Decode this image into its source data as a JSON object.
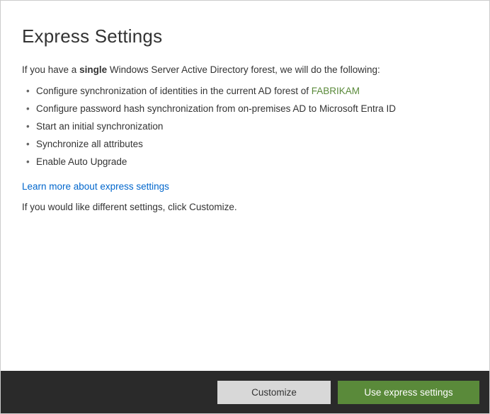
{
  "header": {
    "title": "Express Settings"
  },
  "intro": {
    "prefix": "If you have a ",
    "bold": "single",
    "suffix": " Windows Server Active Directory forest, we will do the following:"
  },
  "bullets": [
    {
      "prefix": "Configure synchronization of identities in the current AD forest of ",
      "forest": "FABRIKAM"
    },
    {
      "text": "Configure password hash synchronization from on-premises AD to Microsoft Entra ID"
    },
    {
      "text": "Start an initial synchronization"
    },
    {
      "text": "Synchronize all attributes"
    },
    {
      "text": "Enable Auto Upgrade"
    }
  ],
  "link": {
    "label": "Learn more about express settings"
  },
  "bottomText": "If you would like different settings, click Customize.",
  "buttons": {
    "secondary": "Customize",
    "primary": "Use express settings"
  }
}
